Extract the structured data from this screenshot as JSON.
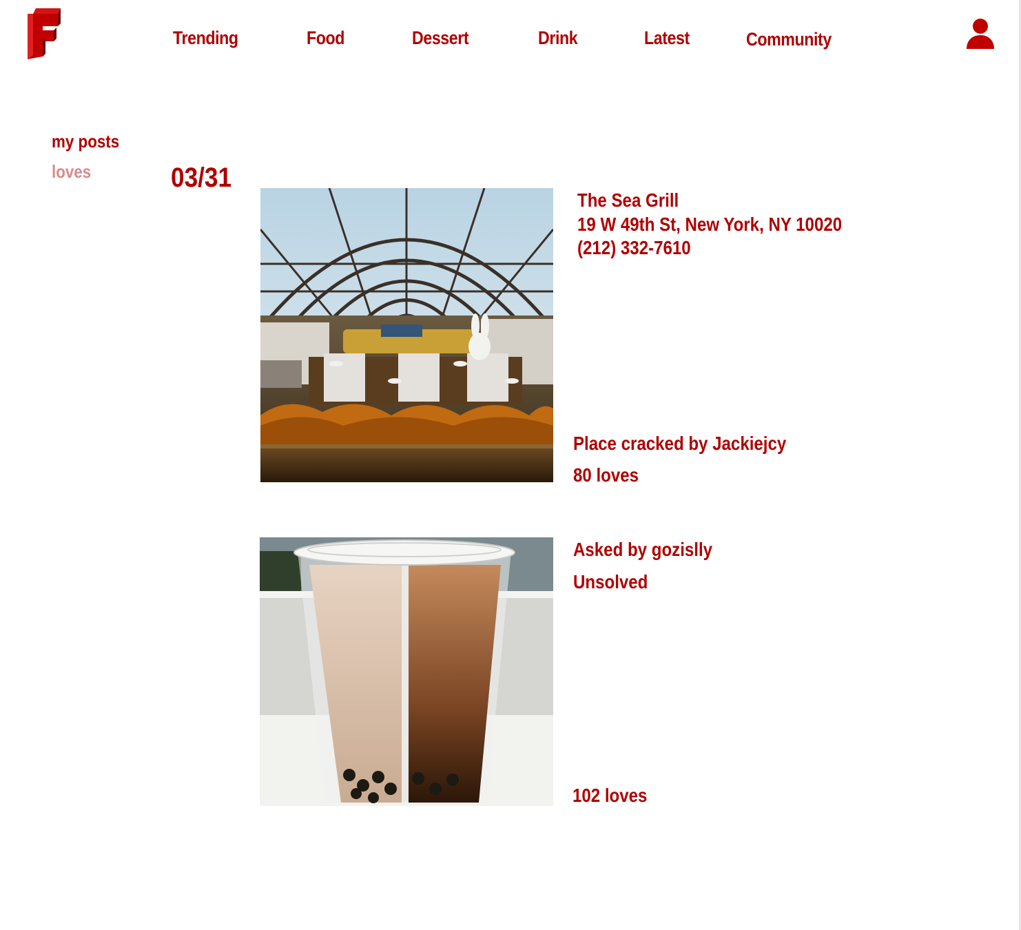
{
  "nav": {
    "items": [
      {
        "label": "Trending"
      },
      {
        "label": "Food"
      },
      {
        "label": "Dessert"
      },
      {
        "label": "Drink"
      },
      {
        "label": "Latest"
      },
      {
        "label": "Community"
      }
    ]
  },
  "sidebar": {
    "my_posts": "my posts",
    "loves": "loves"
  },
  "feed": {
    "date": "03/31",
    "posts": [
      {
        "place_name": "The Sea Grill",
        "address": "19 W 49th St, New York, NY 10020",
        "phone": "(212) 332-7610",
        "cracked_by": "Place cracked by Jackiejcy",
        "loves": "80 loves"
      },
      {
        "asked_by": "Asked by gozislly",
        "status": "Unsolved",
        "loves": "102 loves"
      }
    ]
  },
  "colors": {
    "brand": "#b00000",
    "muted": "#d98a8a"
  },
  "icons": {
    "logo": "f-logo-icon",
    "user": "user-icon"
  }
}
